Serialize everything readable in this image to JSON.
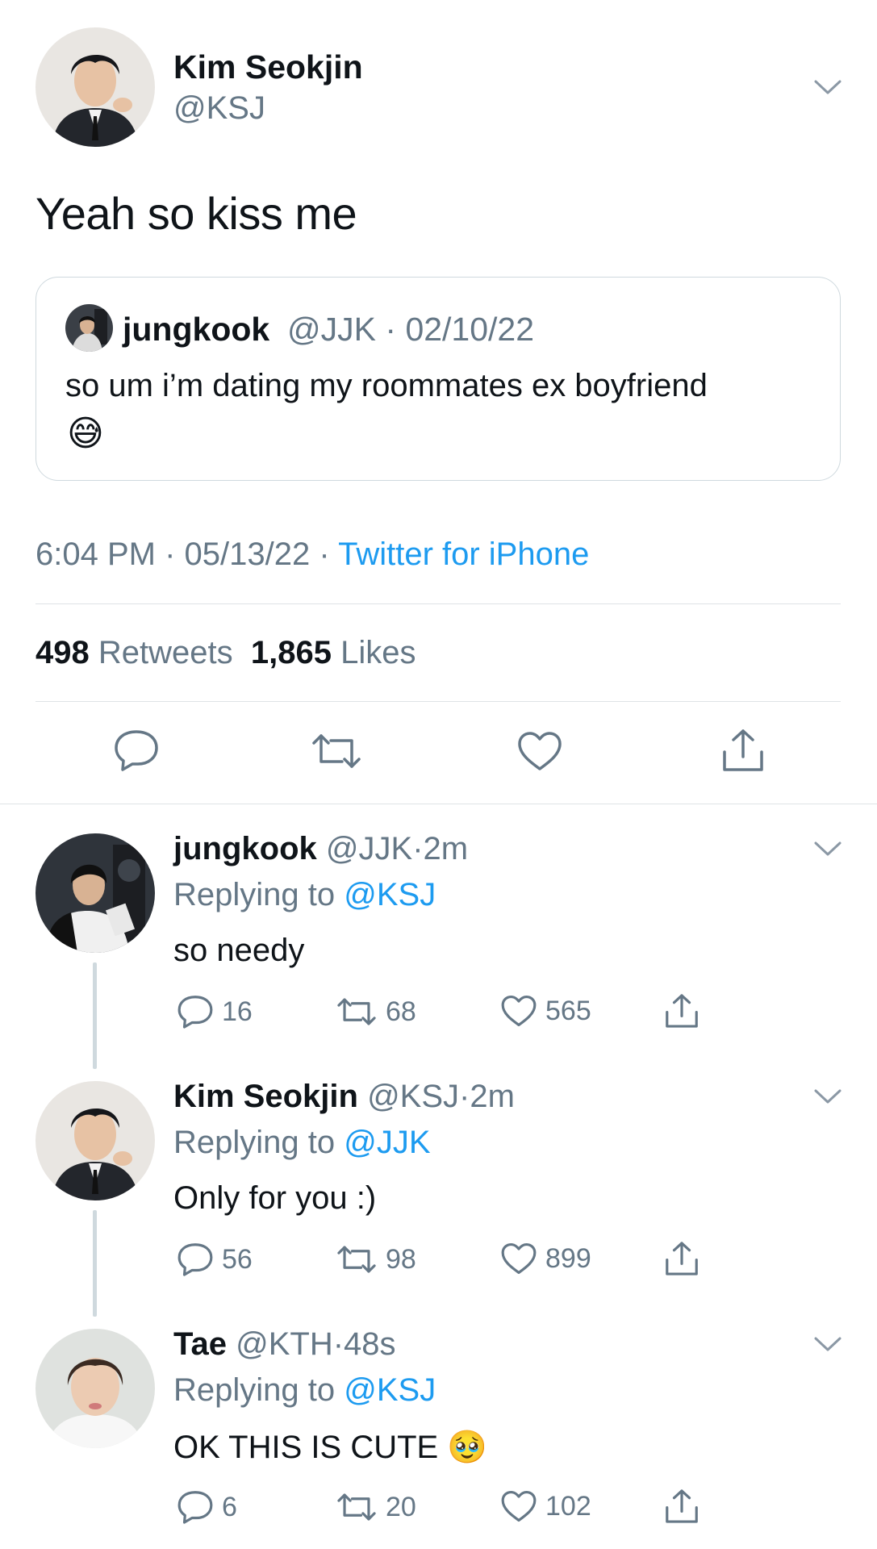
{
  "main_tweet": {
    "display_name": "Kim Seokjin",
    "handle": "@KSJ",
    "text": "Yeah so kiss me",
    "avatar_icon": "person-suit-avatar",
    "quoted": {
      "display_name": "jungkook",
      "handle": "@JJK",
      "sep": "·",
      "date": "02/10/22",
      "text": "so um i’m dating my roommates ex boyfriend",
      "emoji": "😅"
    },
    "time": "6:04 PM",
    "date": "05/13/22",
    "sep": "·",
    "source": "Twitter for iPhone",
    "retweets_count": "498",
    "retweets_label": "Retweets",
    "likes_count": "1,865",
    "likes_label": "Likes"
  },
  "replies": [
    {
      "display_name": "jungkook",
      "handle": "@JJK",
      "sep": "·",
      "time": "2m",
      "replying_prefix": "Replying to",
      "replying_to": "@KSJ",
      "text": "so needy",
      "replies": "16",
      "retweets": "68",
      "likes": "565"
    },
    {
      "display_name": "Kim Seokjin",
      "handle": "@KSJ",
      "sep": "·",
      "time": "2m",
      "replying_prefix": "Replying to",
      "replying_to": "@JJK",
      "text": "Only for you :)",
      "replies": "56",
      "retweets": "98",
      "likes": "899"
    },
    {
      "display_name": "Tae",
      "handle": "@KTH",
      "sep": "·",
      "time": "48s",
      "replying_prefix": "Replying to",
      "replying_to": "@KSJ",
      "text": "OK THIS IS CUTE",
      "emoji": "🥹",
      "replies": "6",
      "retweets": "20",
      "likes": "102"
    }
  ],
  "colors": {
    "accent": "#1d9bf0",
    "secondary_text": "#657786",
    "divider": "#dfe3e6"
  }
}
